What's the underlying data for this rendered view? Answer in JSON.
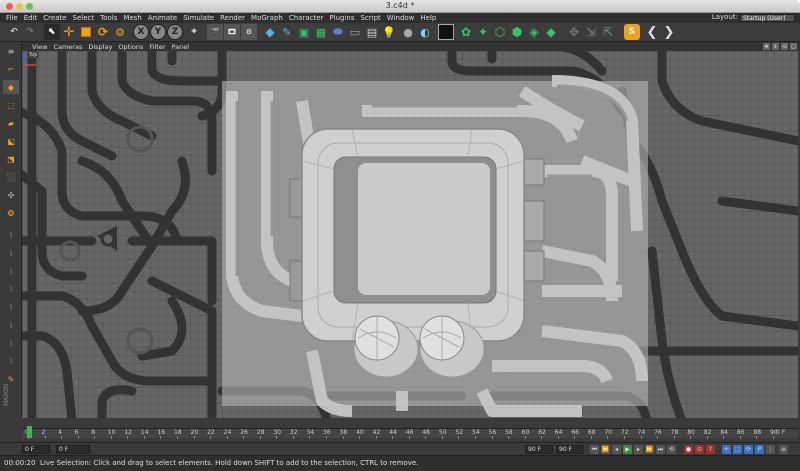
{
  "window": {
    "title": "3.c4d *"
  },
  "menubar": {
    "items": [
      "File",
      "Edit",
      "Create",
      "Select",
      "Tools",
      "Mesh",
      "Animate",
      "Simulate",
      "Render",
      "MoGraph",
      "Character",
      "Plugins",
      "Script",
      "Window",
      "Help"
    ],
    "layout_label": "Layout:",
    "layout_value": "Startup (User)"
  },
  "toolbar": {
    "axis_x": "X",
    "axis_y": "Y",
    "axis_z": "Z"
  },
  "viewport": {
    "menu": [
      "View",
      "Cameras",
      "Display",
      "Options",
      "Filter",
      "Panel"
    ],
    "label": "Top"
  },
  "timeline": {
    "ticks": [
      "0",
      "2",
      "4",
      "6",
      "8",
      "10",
      "12",
      "14",
      "16",
      "18",
      "20",
      "22",
      "24",
      "26",
      "28",
      "30",
      "32",
      "34",
      "36",
      "38",
      "40",
      "42",
      "44",
      "46",
      "48",
      "50",
      "52",
      "54",
      "56",
      "58",
      "60",
      "62",
      "64",
      "66",
      "68",
      "70",
      "72",
      "74",
      "76",
      "78",
      "80",
      "82",
      "84",
      "86",
      "88",
      "90"
    ],
    "end_label": "0 F"
  },
  "transport": {
    "start_field": "0 F",
    "current_field": "0 F",
    "end_field_a": "90 F",
    "end_field_b": "90 F"
  },
  "status": {
    "time": "00:00:20",
    "text": "Live Selection: Click and drag to select elements. Hold down SHIFT to add to the selection, CTRL to remove."
  },
  "colors": {
    "viewport_bg": "#666666",
    "accent_orange": "#f0a020",
    "playhead": "#4caf50"
  }
}
